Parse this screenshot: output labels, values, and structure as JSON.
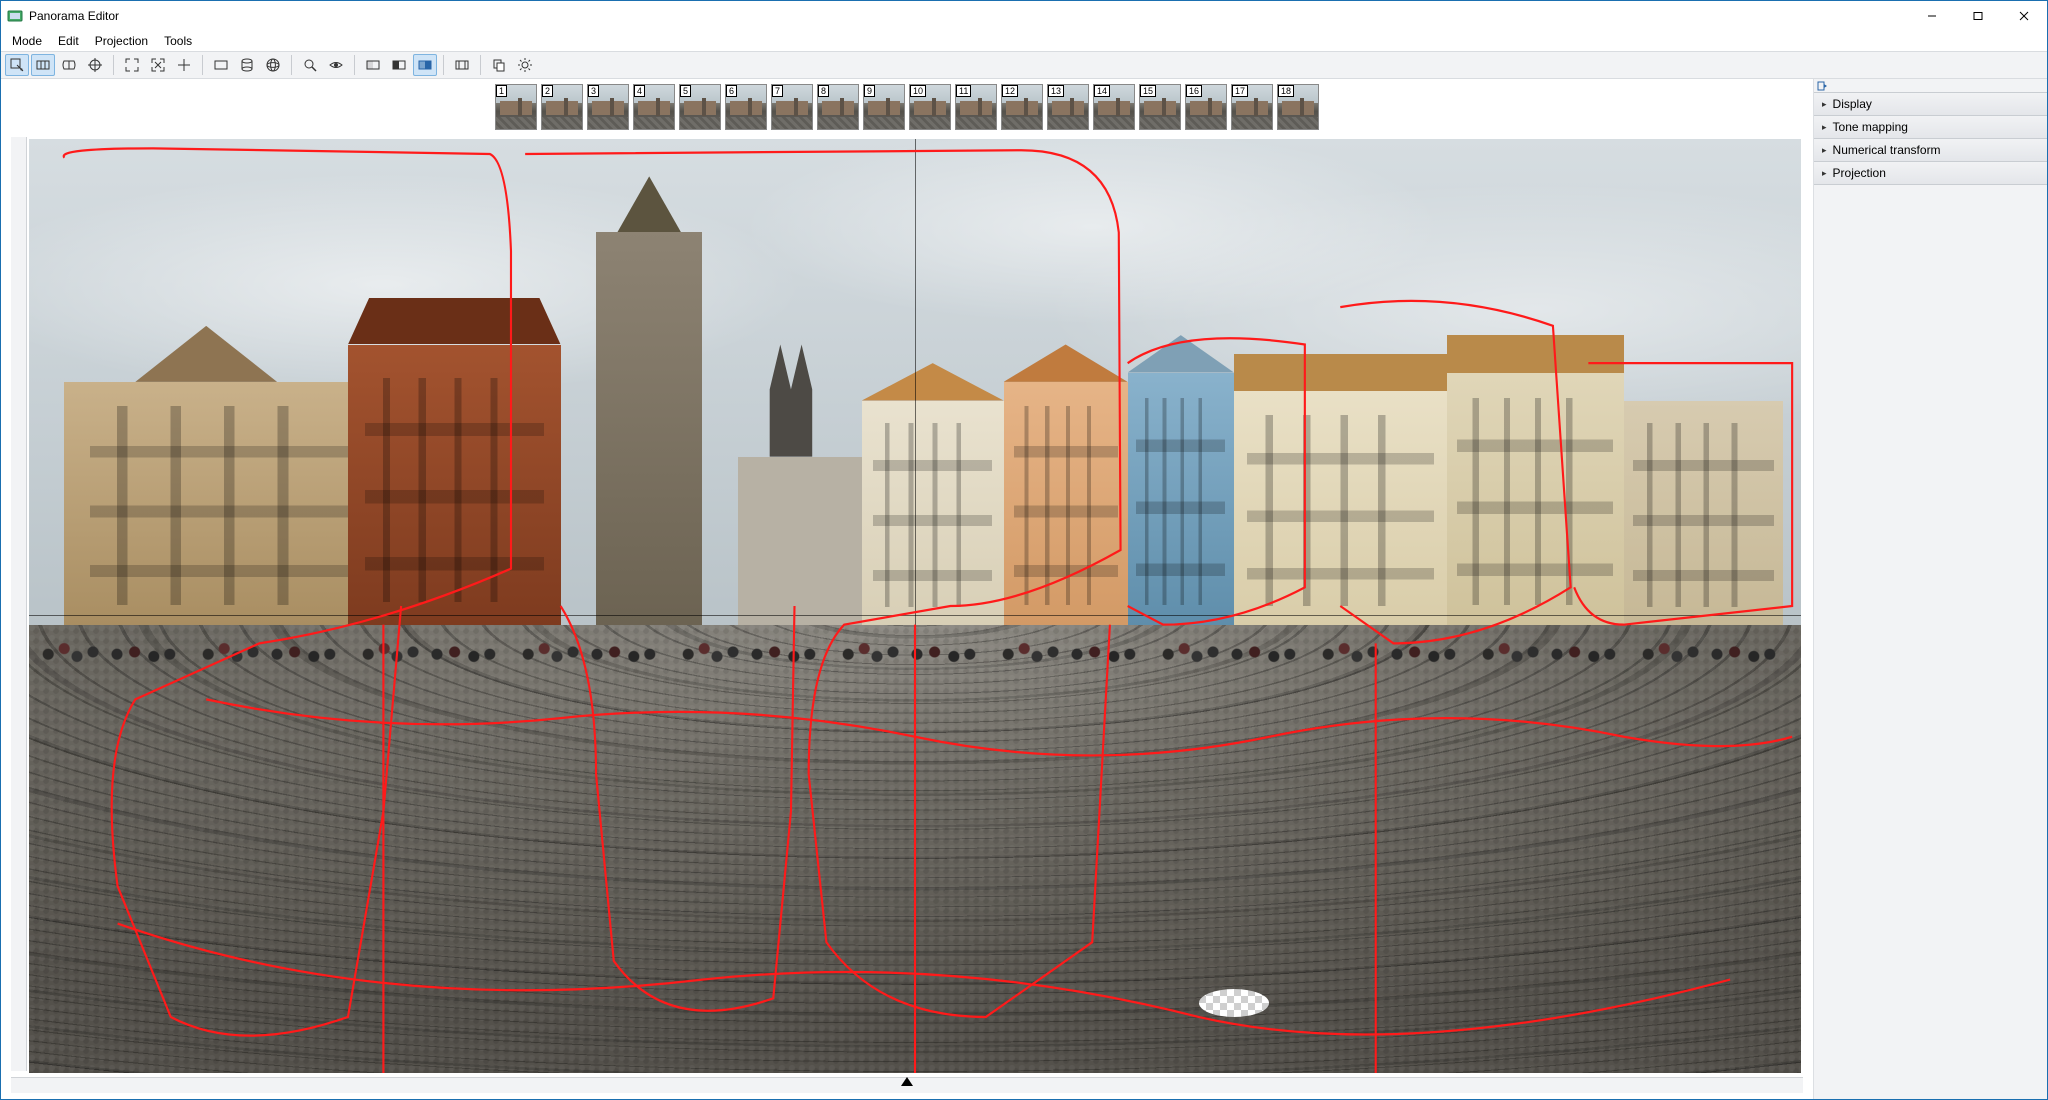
{
  "app": {
    "title": "Panorama Editor"
  },
  "menu": {
    "items": [
      "Mode",
      "Edit",
      "Projection",
      "Tools"
    ]
  },
  "toolbar": {
    "groups": [
      [
        "edit-individual",
        "move-pan",
        "rotate",
        "center"
      ],
      [
        "fit",
        "actual-size",
        "crosshair"
      ],
      [
        "projection-rect",
        "projection-cylinder",
        "projection-sphere"
      ],
      [
        "zoom-tool",
        "preview-eye"
      ],
      [
        "compare-a",
        "compare-b",
        "compare-ab"
      ],
      [
        "grid-3d"
      ],
      [
        "copy",
        "settings"
      ]
    ],
    "active": [
      "edit-individual",
      "move-pan",
      "compare-ab"
    ]
  },
  "thumbnails": {
    "count": 18
  },
  "side": {
    "sections": [
      "Display",
      "Tone mapping",
      "Numerical transform",
      "Projection"
    ]
  },
  "window_controls": {
    "min": "–",
    "max": "□",
    "close": "✕"
  }
}
